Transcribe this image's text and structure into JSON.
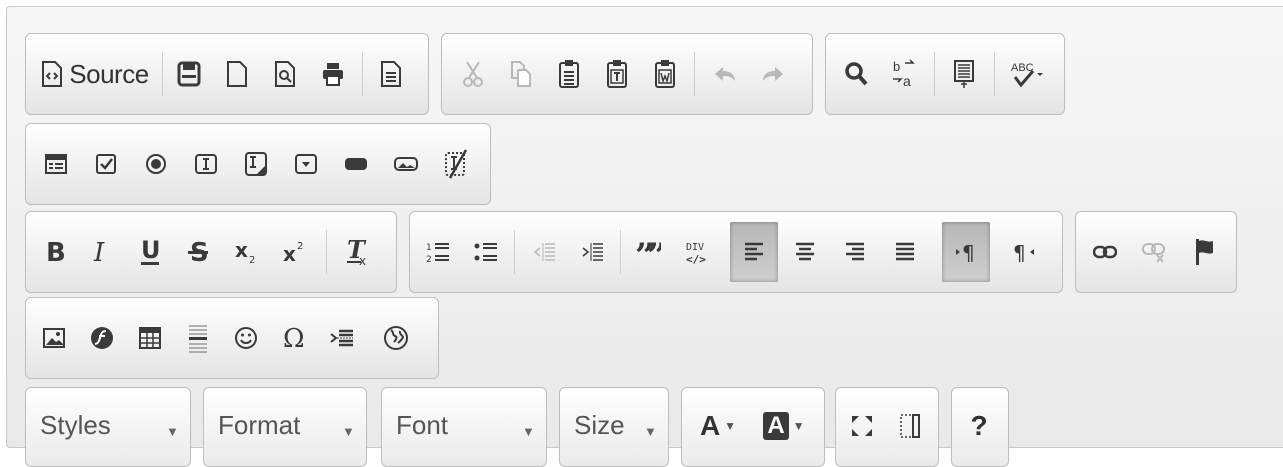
{
  "toolbar": {
    "source_label": "Source",
    "styles_label": "Styles",
    "format_label": "Format",
    "font_label": "Font",
    "size_label": "Size",
    "text_color_label": "A",
    "bg_color_label": "A",
    "help_label": "?"
  },
  "icons": {
    "document": [
      "source-icon",
      "save-icon",
      "new-page-icon",
      "preview-icon",
      "print-icon",
      "templates-icon"
    ],
    "clipboard": [
      "cut-icon",
      "copy-icon",
      "paste-icon",
      "paste-text-icon",
      "paste-word-icon",
      "undo-icon",
      "redo-icon"
    ],
    "editing": [
      "find-icon",
      "replace-icon",
      "select-all-icon",
      "spellcheck-icon"
    ],
    "forms": [
      "form-icon",
      "checkbox-icon",
      "radio-icon",
      "textfield-icon",
      "textarea-icon",
      "select-icon",
      "button-icon",
      "image-button-icon",
      "hidden-field-icon"
    ],
    "basic": [
      "bold-icon",
      "italic-icon",
      "underline-icon",
      "strike-icon",
      "subscript-icon",
      "superscript-icon",
      "remove-format-icon"
    ],
    "paragraph": [
      "numbered-list-icon",
      "bulleted-list-icon",
      "outdent-icon",
      "indent-icon",
      "blockquote-icon",
      "create-div-icon",
      "align-left-icon",
      "align-center-icon",
      "align-right-icon",
      "justify-icon",
      "ltr-icon",
      "rtl-icon"
    ],
    "links": [
      "link-icon",
      "unlink-icon",
      "anchor-icon"
    ],
    "insert": [
      "image-icon",
      "flash-icon",
      "table-icon",
      "horizontal-rule-icon",
      "smiley-icon",
      "special-char-icon",
      "page-break-icon",
      "iframe-icon"
    ]
  },
  "state": {
    "active_buttons": [
      "align-left",
      "ltr"
    ],
    "disabled_buttons": [
      "cut",
      "copy",
      "undo",
      "redo",
      "outdent",
      "unlink"
    ]
  },
  "colors": {
    "toolbar_bg": "#eaeaea",
    "icon": "#3a3a3a",
    "disabled_icon": "#b8b8b8",
    "group_border": "#bdbdbd",
    "active_bg": "#c2c2c2"
  }
}
